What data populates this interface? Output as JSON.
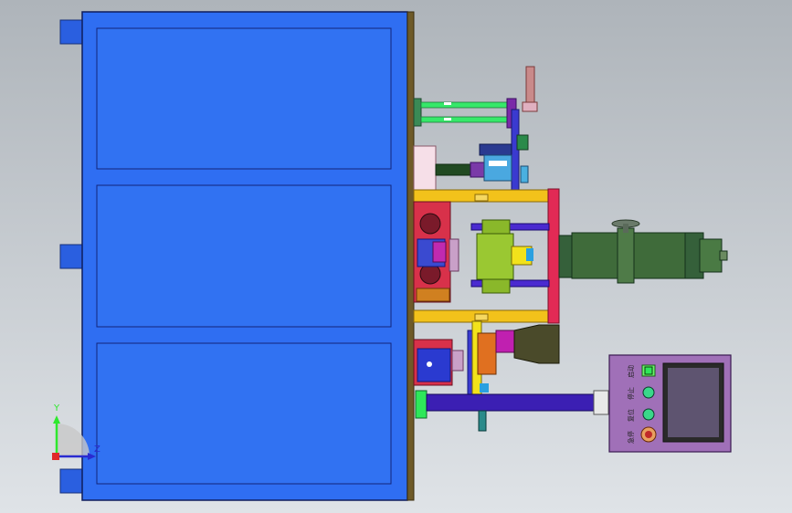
{
  "view": {
    "axes": {
      "y_label": "Y",
      "z_label": "Z"
    }
  },
  "control_panel": {
    "labels": [
      "启动",
      "停止",
      "复位",
      "急停"
    ]
  },
  "colors": {
    "cabinet_blue": "#2f6ef2",
    "cabinet_panel_line": "#1a2f8a",
    "yellow_rail": "#f2c21b",
    "red_plate": "#e22a55",
    "motor_green": "#3f6b3a",
    "shaft_purple": "#3b1fb3",
    "panel_purple": "#a070b8",
    "screen_gray": "#5e5470",
    "accent_green": "#2ee85a"
  }
}
